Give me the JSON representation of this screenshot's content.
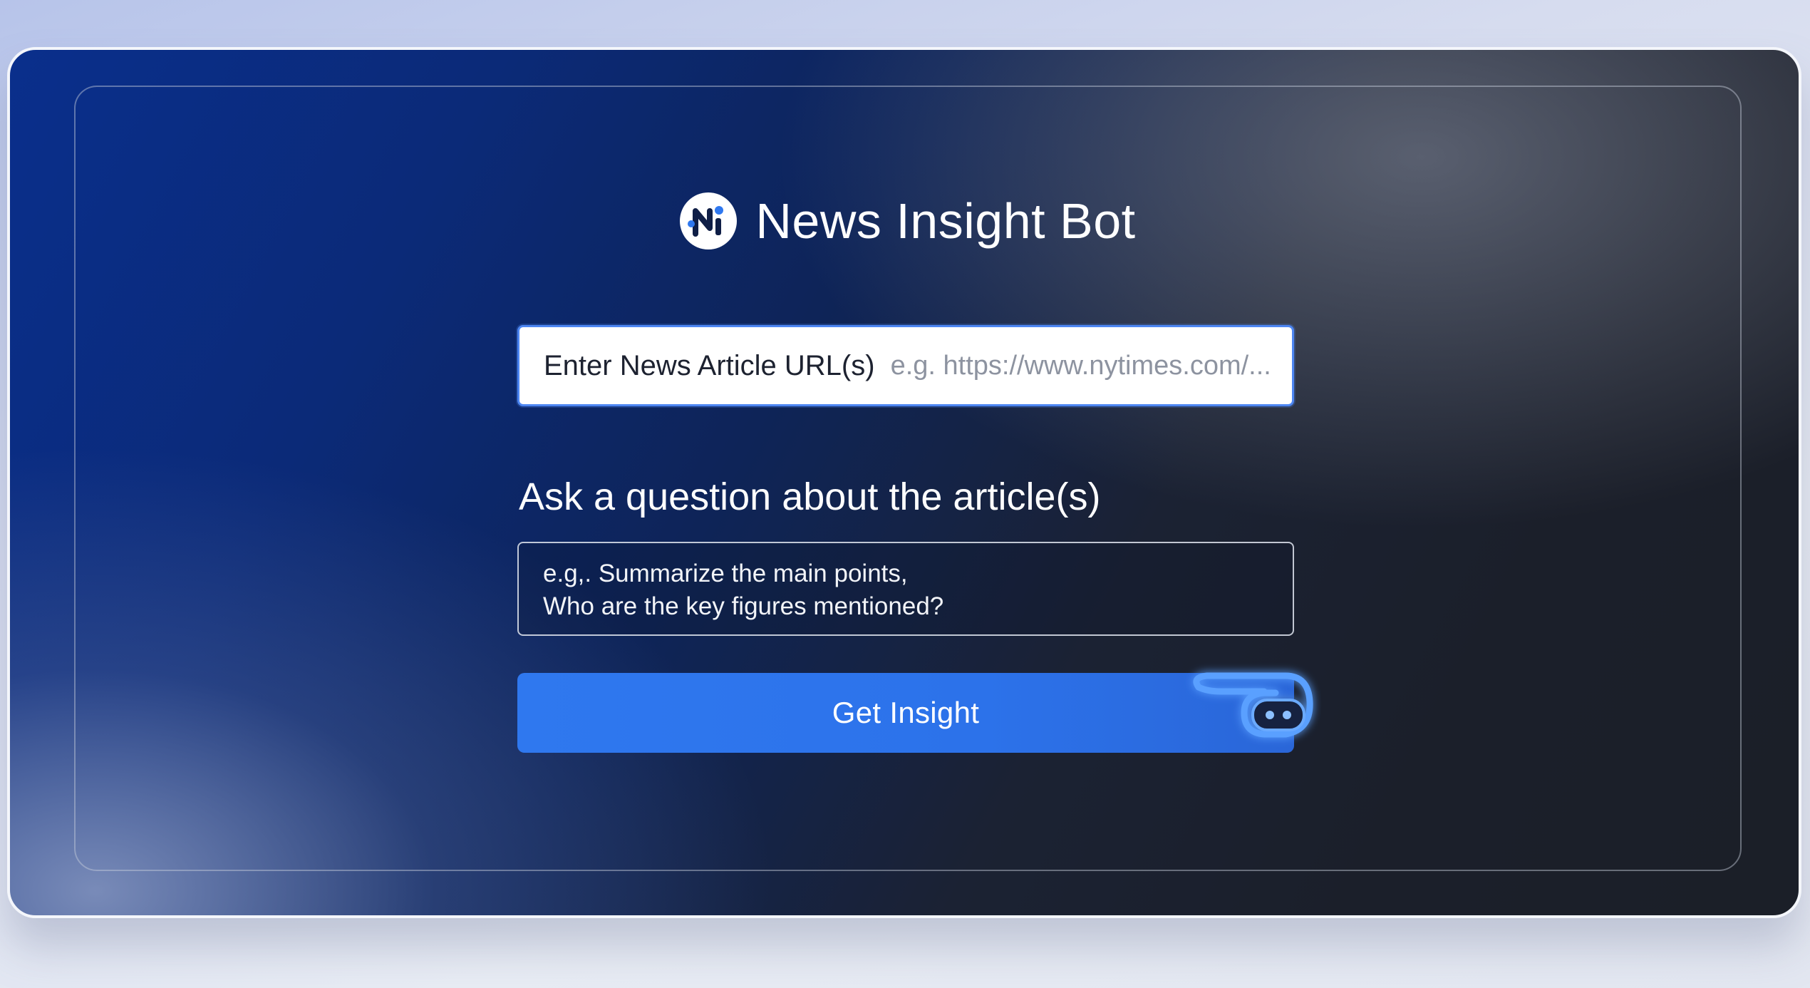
{
  "app": {
    "title": "News Insight Bot",
    "logo_icon": "ni-logo-icon",
    "colors": {
      "accent": "#2f78ef",
      "window_bg_start": "#0a2f8c",
      "window_bg_end": "#1b1f28"
    }
  },
  "url_field": {
    "label": "Enter News Article URL(s)",
    "placeholder": "e.g. https://www.nytimes.com/...",
    "value": ""
  },
  "question": {
    "label": "Ask a question about the article(s)",
    "placeholder_lines": [
      "e.g,. Summarize the main points,",
      "Who are the key figures mentioned?"
    ]
  },
  "action": {
    "button_label": "Get Insight",
    "icon": "robot-icon"
  }
}
